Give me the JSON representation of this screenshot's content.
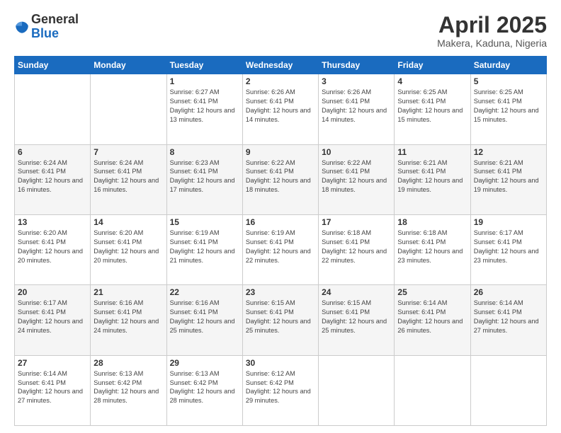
{
  "logo": {
    "general": "General",
    "blue": "Blue"
  },
  "title": "April 2025",
  "location": "Makera, Kaduna, Nigeria",
  "days_of_week": [
    "Sunday",
    "Monday",
    "Tuesday",
    "Wednesday",
    "Thursday",
    "Friday",
    "Saturday"
  ],
  "weeks": [
    [
      {
        "day": "",
        "sunrise": "",
        "sunset": "",
        "daylight": ""
      },
      {
        "day": "",
        "sunrise": "",
        "sunset": "",
        "daylight": ""
      },
      {
        "day": "1",
        "sunrise": "Sunrise: 6:27 AM",
        "sunset": "Sunset: 6:41 PM",
        "daylight": "Daylight: 12 hours and 13 minutes."
      },
      {
        "day": "2",
        "sunrise": "Sunrise: 6:26 AM",
        "sunset": "Sunset: 6:41 PM",
        "daylight": "Daylight: 12 hours and 14 minutes."
      },
      {
        "day": "3",
        "sunrise": "Sunrise: 6:26 AM",
        "sunset": "Sunset: 6:41 PM",
        "daylight": "Daylight: 12 hours and 14 minutes."
      },
      {
        "day": "4",
        "sunrise": "Sunrise: 6:25 AM",
        "sunset": "Sunset: 6:41 PM",
        "daylight": "Daylight: 12 hours and 15 minutes."
      },
      {
        "day": "5",
        "sunrise": "Sunrise: 6:25 AM",
        "sunset": "Sunset: 6:41 PM",
        "daylight": "Daylight: 12 hours and 15 minutes."
      }
    ],
    [
      {
        "day": "6",
        "sunrise": "Sunrise: 6:24 AM",
        "sunset": "Sunset: 6:41 PM",
        "daylight": "Daylight: 12 hours and 16 minutes."
      },
      {
        "day": "7",
        "sunrise": "Sunrise: 6:24 AM",
        "sunset": "Sunset: 6:41 PM",
        "daylight": "Daylight: 12 hours and 16 minutes."
      },
      {
        "day": "8",
        "sunrise": "Sunrise: 6:23 AM",
        "sunset": "Sunset: 6:41 PM",
        "daylight": "Daylight: 12 hours and 17 minutes."
      },
      {
        "day": "9",
        "sunrise": "Sunrise: 6:22 AM",
        "sunset": "Sunset: 6:41 PM",
        "daylight": "Daylight: 12 hours and 18 minutes."
      },
      {
        "day": "10",
        "sunrise": "Sunrise: 6:22 AM",
        "sunset": "Sunset: 6:41 PM",
        "daylight": "Daylight: 12 hours and 18 minutes."
      },
      {
        "day": "11",
        "sunrise": "Sunrise: 6:21 AM",
        "sunset": "Sunset: 6:41 PM",
        "daylight": "Daylight: 12 hours and 19 minutes."
      },
      {
        "day": "12",
        "sunrise": "Sunrise: 6:21 AM",
        "sunset": "Sunset: 6:41 PM",
        "daylight": "Daylight: 12 hours and 19 minutes."
      }
    ],
    [
      {
        "day": "13",
        "sunrise": "Sunrise: 6:20 AM",
        "sunset": "Sunset: 6:41 PM",
        "daylight": "Daylight: 12 hours and 20 minutes."
      },
      {
        "day": "14",
        "sunrise": "Sunrise: 6:20 AM",
        "sunset": "Sunset: 6:41 PM",
        "daylight": "Daylight: 12 hours and 20 minutes."
      },
      {
        "day": "15",
        "sunrise": "Sunrise: 6:19 AM",
        "sunset": "Sunset: 6:41 PM",
        "daylight": "Daylight: 12 hours and 21 minutes."
      },
      {
        "day": "16",
        "sunrise": "Sunrise: 6:19 AM",
        "sunset": "Sunset: 6:41 PM",
        "daylight": "Daylight: 12 hours and 22 minutes."
      },
      {
        "day": "17",
        "sunrise": "Sunrise: 6:18 AM",
        "sunset": "Sunset: 6:41 PM",
        "daylight": "Daylight: 12 hours and 22 minutes."
      },
      {
        "day": "18",
        "sunrise": "Sunrise: 6:18 AM",
        "sunset": "Sunset: 6:41 PM",
        "daylight": "Daylight: 12 hours and 23 minutes."
      },
      {
        "day": "19",
        "sunrise": "Sunrise: 6:17 AM",
        "sunset": "Sunset: 6:41 PM",
        "daylight": "Daylight: 12 hours and 23 minutes."
      }
    ],
    [
      {
        "day": "20",
        "sunrise": "Sunrise: 6:17 AM",
        "sunset": "Sunset: 6:41 PM",
        "daylight": "Daylight: 12 hours and 24 minutes."
      },
      {
        "day": "21",
        "sunrise": "Sunrise: 6:16 AM",
        "sunset": "Sunset: 6:41 PM",
        "daylight": "Daylight: 12 hours and 24 minutes."
      },
      {
        "day": "22",
        "sunrise": "Sunrise: 6:16 AM",
        "sunset": "Sunset: 6:41 PM",
        "daylight": "Daylight: 12 hours and 25 minutes."
      },
      {
        "day": "23",
        "sunrise": "Sunrise: 6:15 AM",
        "sunset": "Sunset: 6:41 PM",
        "daylight": "Daylight: 12 hours and 25 minutes."
      },
      {
        "day": "24",
        "sunrise": "Sunrise: 6:15 AM",
        "sunset": "Sunset: 6:41 PM",
        "daylight": "Daylight: 12 hours and 25 minutes."
      },
      {
        "day": "25",
        "sunrise": "Sunrise: 6:14 AM",
        "sunset": "Sunset: 6:41 PM",
        "daylight": "Daylight: 12 hours and 26 minutes."
      },
      {
        "day": "26",
        "sunrise": "Sunrise: 6:14 AM",
        "sunset": "Sunset: 6:41 PM",
        "daylight": "Daylight: 12 hours and 27 minutes."
      }
    ],
    [
      {
        "day": "27",
        "sunrise": "Sunrise: 6:14 AM",
        "sunset": "Sunset: 6:41 PM",
        "daylight": "Daylight: 12 hours and 27 minutes."
      },
      {
        "day": "28",
        "sunrise": "Sunrise: 6:13 AM",
        "sunset": "Sunset: 6:42 PM",
        "daylight": "Daylight: 12 hours and 28 minutes."
      },
      {
        "day": "29",
        "sunrise": "Sunrise: 6:13 AM",
        "sunset": "Sunset: 6:42 PM",
        "daylight": "Daylight: 12 hours and 28 minutes."
      },
      {
        "day": "30",
        "sunrise": "Sunrise: 6:12 AM",
        "sunset": "Sunset: 6:42 PM",
        "daylight": "Daylight: 12 hours and 29 minutes."
      },
      {
        "day": "",
        "sunrise": "",
        "sunset": "",
        "daylight": ""
      },
      {
        "day": "",
        "sunrise": "",
        "sunset": "",
        "daylight": ""
      },
      {
        "day": "",
        "sunrise": "",
        "sunset": "",
        "daylight": ""
      }
    ]
  ]
}
